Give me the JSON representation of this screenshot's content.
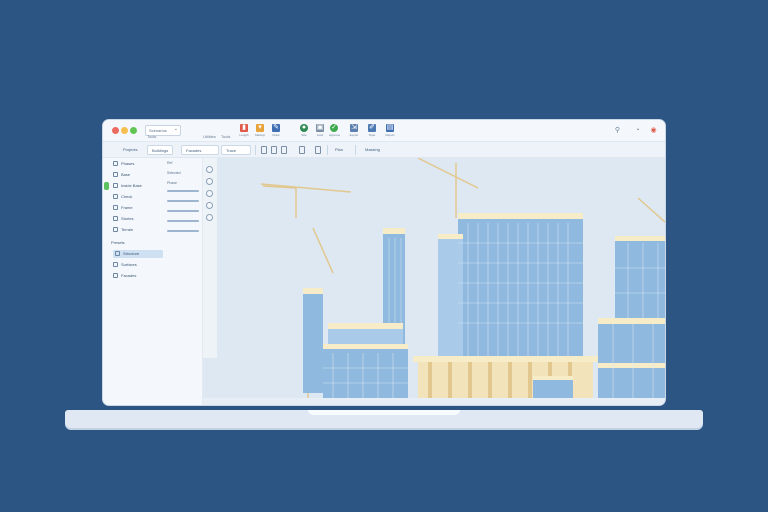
{
  "window": {
    "app_select": "Scenarios",
    "menu": [
      "Tools",
      "Utilities",
      "Tools"
    ],
    "tools": [
      {
        "icon": "ruler-icon",
        "color": "#e05a4a",
        "label": "Length"
      },
      {
        "icon": "pin-icon",
        "color": "#e7a23a",
        "label": "Markup"
      },
      {
        "icon": "pencil-icon",
        "color": "#3f6fb3",
        "label": "Draw"
      },
      {
        "icon": "location-icon",
        "color": "#2f8a52",
        "label": "Site"
      },
      {
        "icon": "lock-icon",
        "color": "#7a8fa6",
        "label": "Lock"
      },
      {
        "icon": "check-icon",
        "color": "#3faa4f",
        "label": "Approve"
      },
      {
        "icon": "export-icon",
        "color": "#5a7fb0",
        "label": "Export"
      },
      {
        "icon": "brush-icon",
        "color": "#4d79b3",
        "label": "Style"
      },
      {
        "icon": "report-icon",
        "color": "#3f6fb3",
        "label": "Report"
      }
    ]
  },
  "breadcrumbs": {
    "root": "Projects",
    "current": "Buildings",
    "tab": "Facades",
    "view": "Trace",
    "plan": "Plan",
    "extra": "Massing"
  },
  "sidebar": {
    "items": [
      {
        "icon": "stack-icon",
        "label": "Phases"
      },
      {
        "icon": "grid-icon",
        "label": "Base"
      },
      {
        "icon": "layers-icon",
        "label": "Inside Base"
      },
      {
        "icon": "floor-icon",
        "label": "Check"
      },
      {
        "icon": "frame-icon",
        "label": "Frame"
      },
      {
        "icon": "folder-icon",
        "label": "Stories"
      },
      {
        "icon": "terrain-icon",
        "label": "Terrain"
      }
    ],
    "section_title": "Presets",
    "section_items": [
      {
        "icon": "building-icon",
        "label": "Structure",
        "active": true
      },
      {
        "icon": "building-icon",
        "label": "Surfaces",
        "active": false
      },
      {
        "icon": "building-icon",
        "label": "Facades",
        "active": false
      }
    ],
    "props": [
      "Ref",
      "Selected",
      "Phase"
    ]
  },
  "colors": {
    "brand_bg": "#2c5584",
    "canvas_bg": "#dde8f2",
    "glass": "#8fb9de",
    "glass_dark": "#6ea3d3",
    "slab": "#f6edc8",
    "accent": "#e2c88f"
  }
}
